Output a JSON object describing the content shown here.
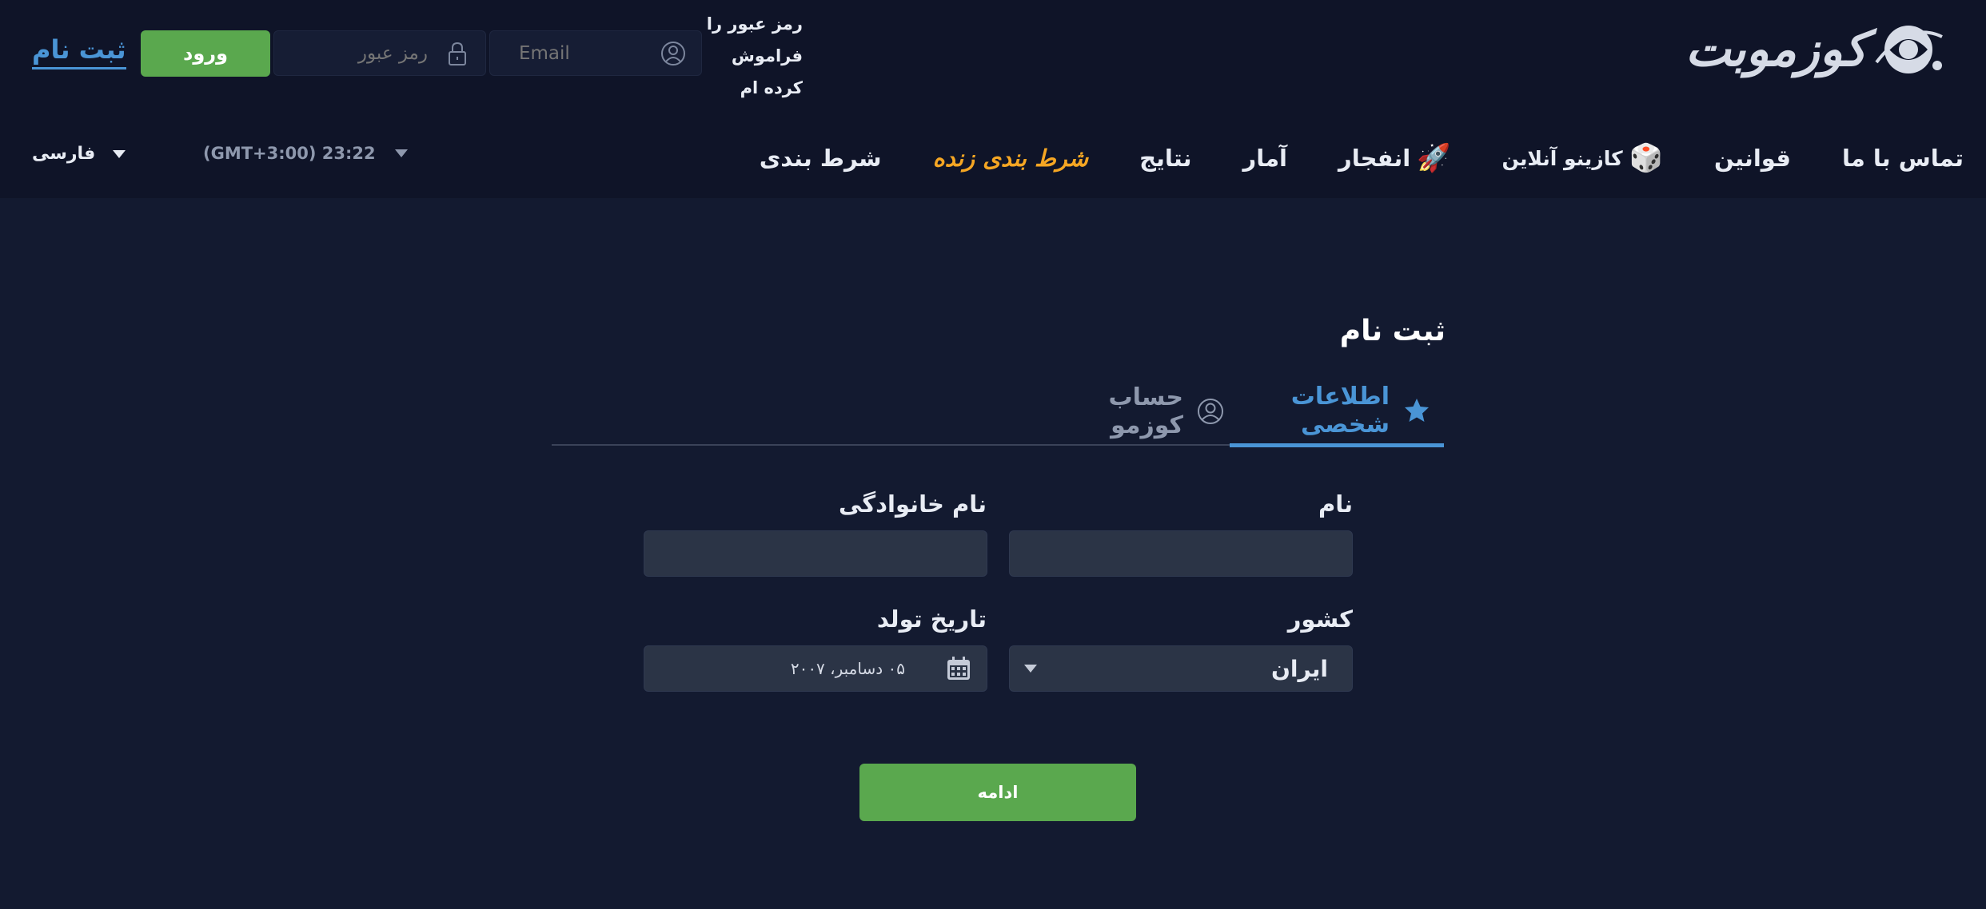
{
  "brand": {
    "logo_text": "کوزموبت"
  },
  "header": {
    "forgot_password": "رمز عبور را فراموش کرده ام",
    "email_placeholder": "Email",
    "password_placeholder": "رمز عبور",
    "login_label": "ورود",
    "register_label": "ثبت نام"
  },
  "nav": {
    "items": [
      {
        "label": "شرط بندی",
        "active": false
      },
      {
        "label": "شرط بندی زنده",
        "active": true
      },
      {
        "label": "نتایج",
        "active": false
      },
      {
        "label": "آمار",
        "active": false
      },
      {
        "label": "انفجار",
        "icon": "rocket-icon"
      },
      {
        "label": "کازینو آنلاین",
        "icon": "dice-icon"
      },
      {
        "label": "قوانین",
        "active": false
      },
      {
        "label": "تماس با ما",
        "active": false
      }
    ],
    "timezone": "(GMT+3:00) 23:22",
    "language": "فارسی"
  },
  "form": {
    "title": "ثبت نام",
    "tabs": [
      {
        "label": "اطلاعات شخصی",
        "icon": "star-icon",
        "active": true
      },
      {
        "label": "حساب کوزمو",
        "icon": "user-circle-icon",
        "active": false
      }
    ],
    "first_name_label": "نام",
    "last_name_label": "نام خانوادگی",
    "country_label": "کشور",
    "country_value": "ایران",
    "dob_label": "تاریخ تولد",
    "dob_value": "۰۵ دسامبر، ۲۰۰۷",
    "continue_label": "ادامه"
  },
  "colors": {
    "accent_green": "#5aa84e",
    "accent_blue": "#4a95d6",
    "live_orange": "#f5a623",
    "background": "#131a30",
    "header_bg": "#0f1428"
  }
}
